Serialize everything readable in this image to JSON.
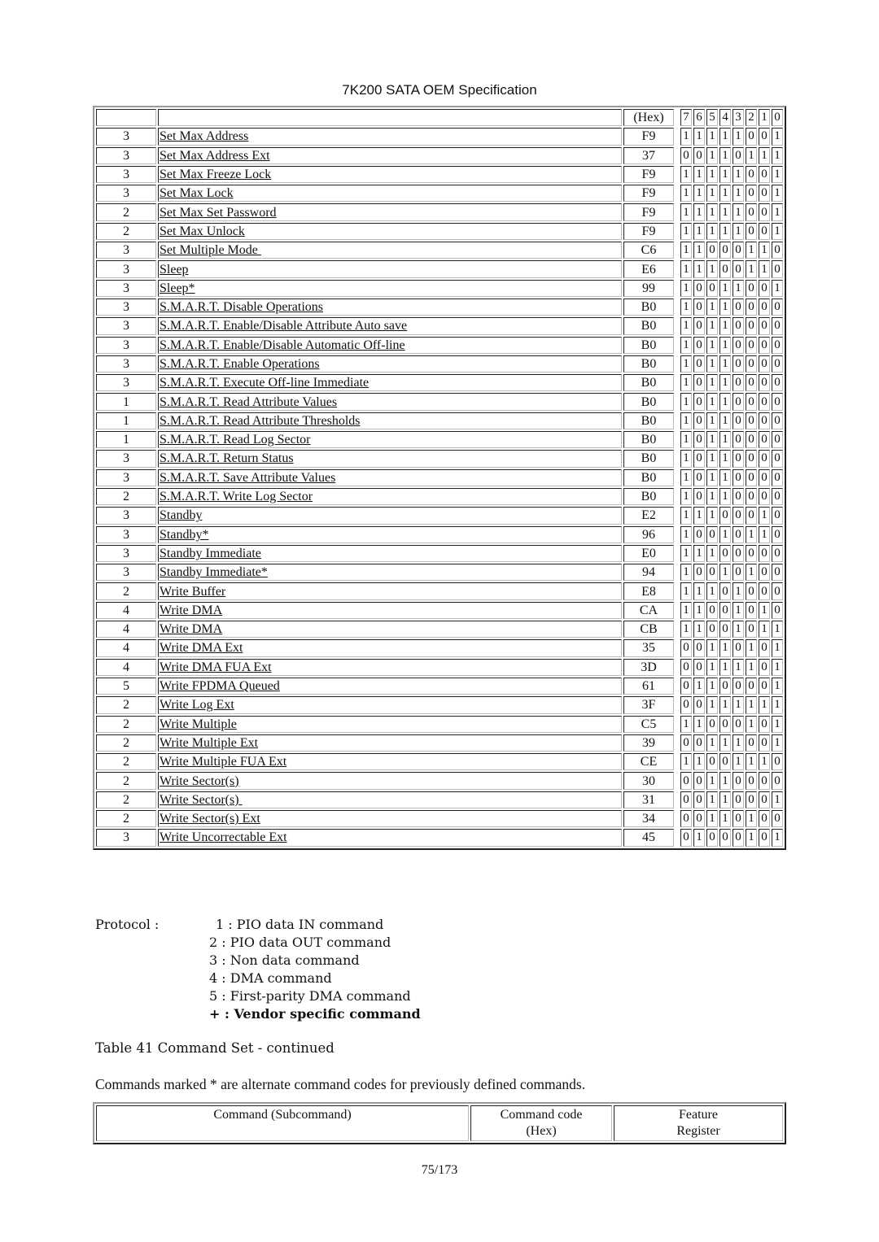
{
  "header": {
    "title": "7K200 SATA OEM Specification"
  },
  "table": {
    "header_row": {
      "protocol": "",
      "command": "",
      "hex": "(Hex)",
      "bits": [
        "7",
        "6",
        "5",
        "4",
        "3",
        "2",
        "1",
        "0"
      ]
    },
    "rows": [
      {
        "protocol": "3",
        "command": "Set Max Address",
        "hex": "F9",
        "bits": [
          "1",
          "1",
          "1",
          "1",
          "1",
          "0",
          "0",
          "1"
        ]
      },
      {
        "protocol": "3",
        "command": "Set Max Address Ext",
        "hex": "37",
        "bits": [
          "0",
          "0",
          "1",
          "1",
          "0",
          "1",
          "1",
          "1"
        ]
      },
      {
        "protocol": "3",
        "command": "Set Max Freeze Lock",
        "hex": "F9",
        "bits": [
          "1",
          "1",
          "1",
          "1",
          "1",
          "0",
          "0",
          "1"
        ]
      },
      {
        "protocol": "3",
        "command": "Set Max Lock",
        "hex": "F9",
        "bits": [
          "1",
          "1",
          "1",
          "1",
          "1",
          "0",
          "0",
          "1"
        ]
      },
      {
        "protocol": "2",
        "command": "Set Max Set Password",
        "hex": "F9",
        "bits": [
          "1",
          "1",
          "1",
          "1",
          "1",
          "0",
          "0",
          "1"
        ]
      },
      {
        "protocol": "2",
        "command": "Set Max Unlock",
        "hex": "F9",
        "bits": [
          "1",
          "1",
          "1",
          "1",
          "1",
          "0",
          "0",
          "1"
        ]
      },
      {
        "protocol": "3",
        "command": "Set Multiple Mode ",
        "hex": "C6",
        "bits": [
          "1",
          "1",
          "0",
          "0",
          "0",
          "1",
          "1",
          "0"
        ]
      },
      {
        "protocol": "3",
        "command": "Sleep",
        "hex": "E6",
        "bits": [
          "1",
          "1",
          "1",
          "0",
          "0",
          "1",
          "1",
          "0"
        ]
      },
      {
        "protocol": "3",
        "command": "Sleep*",
        "hex": "99",
        "bits": [
          "1",
          "0",
          "0",
          "1",
          "1",
          "0",
          "0",
          "1"
        ]
      },
      {
        "protocol": "3",
        "command": "S.M.A.R.T. Disable Operations",
        "hex": "B0",
        "bits": [
          "1",
          "0",
          "1",
          "1",
          "0",
          "0",
          "0",
          "0"
        ]
      },
      {
        "protocol": "3",
        "command": "S.M.A.R.T. Enable/Disable Attribute Auto save",
        "hex": "B0",
        "bits": [
          "1",
          "0",
          "1",
          "1",
          "0",
          "0",
          "0",
          "0"
        ]
      },
      {
        "protocol": "3",
        "command": "S.M.A.R.T. Enable/Disable Automatic Off-line",
        "hex": "B0",
        "bits": [
          "1",
          "0",
          "1",
          "1",
          "0",
          "0",
          "0",
          "0"
        ]
      },
      {
        "protocol": "3",
        "command": "S.M.A.R.T. Enable Operations",
        "hex": "B0",
        "bits": [
          "1",
          "0",
          "1",
          "1",
          "0",
          "0",
          "0",
          "0"
        ]
      },
      {
        "protocol": "3",
        "command": "S.M.A.R.T. Execute Off-line Immediate",
        "hex": "B0",
        "bits": [
          "1",
          "0",
          "1",
          "1",
          "0",
          "0",
          "0",
          "0"
        ]
      },
      {
        "protocol": "1",
        "command": "S.M.A.R.T. Read Attribute Values",
        "hex": "B0",
        "bits": [
          "1",
          "0",
          "1",
          "1",
          "0",
          "0",
          "0",
          "0"
        ]
      },
      {
        "protocol": "1",
        "command": "S.M.A.R.T. Read Attribute Thresholds",
        "hex": "B0",
        "bits": [
          "1",
          "0",
          "1",
          "1",
          "0",
          "0",
          "0",
          "0"
        ]
      },
      {
        "protocol": "1",
        "command": "S.M.A.R.T. Read Log Sector",
        "hex": "B0",
        "bits": [
          "1",
          "0",
          "1",
          "1",
          "0",
          "0",
          "0",
          "0"
        ]
      },
      {
        "protocol": "3",
        "command": "S.M.A.R.T. Return Status",
        "hex": "B0",
        "bits": [
          "1",
          "0",
          "1",
          "1",
          "0",
          "0",
          "0",
          "0"
        ]
      },
      {
        "protocol": "3",
        "command": "S.M.A.R.T. Save Attribute Values",
        "hex": "B0",
        "bits": [
          "1",
          "0",
          "1",
          "1",
          "0",
          "0",
          "0",
          "0"
        ]
      },
      {
        "protocol": "2",
        "command": "S.M.A.R.T. Write Log Sector",
        "hex": "B0",
        "bits": [
          "1",
          "0",
          "1",
          "1",
          "0",
          "0",
          "0",
          "0"
        ]
      },
      {
        "protocol": "3",
        "command": "Standby",
        "hex": "E2",
        "bits": [
          "1",
          "1",
          "1",
          "0",
          "0",
          "0",
          "1",
          "0"
        ]
      },
      {
        "protocol": "3",
        "command": "Standby*",
        "hex": "96",
        "bits": [
          "1",
          "0",
          "0",
          "1",
          "0",
          "1",
          "1",
          "0"
        ]
      },
      {
        "protocol": "3",
        "command": "Standby Immediate",
        "hex": "E0",
        "bits": [
          "1",
          "1",
          "1",
          "0",
          "0",
          "0",
          "0",
          "0"
        ]
      },
      {
        "protocol": "3",
        "command": "Standby Immediate*",
        "hex": "94",
        "bits": [
          "1",
          "0",
          "0",
          "1",
          "0",
          "1",
          "0",
          "0"
        ]
      },
      {
        "protocol": "2",
        "command": "Write Buffer",
        "hex": "E8",
        "bits": [
          "1",
          "1",
          "1",
          "0",
          "1",
          "0",
          "0",
          "0"
        ]
      },
      {
        "protocol": "4",
        "command": "Write DMA",
        "hex": "CA",
        "bits": [
          "1",
          "1",
          "0",
          "0",
          "1",
          "0",
          "1",
          "0"
        ]
      },
      {
        "protocol": "4",
        "command": "Write DMA",
        "hex": "CB",
        "bits": [
          "1",
          "1",
          "0",
          "0",
          "1",
          "0",
          "1",
          "1"
        ]
      },
      {
        "protocol": "4",
        "command": "Write DMA Ext",
        "hex": "35",
        "bits": [
          "0",
          "0",
          "1",
          "1",
          "0",
          "1",
          "0",
          "1"
        ]
      },
      {
        "protocol": "4",
        "command": "Write DMA FUA Ext",
        "hex": "3D",
        "bits": [
          "0",
          "0",
          "1",
          "1",
          "1",
          "1",
          "0",
          "1"
        ]
      },
      {
        "protocol": "5",
        "command": "Write FPDMA Queued",
        "hex": "61",
        "bits": [
          "0",
          "1",
          "1",
          "0",
          "0",
          "0",
          "0",
          "1"
        ]
      },
      {
        "protocol": "2",
        "command": "Write Log Ext",
        "hex": "3F",
        "bits": [
          "0",
          "0",
          "1",
          "1",
          "1",
          "1",
          "1",
          "1"
        ]
      },
      {
        "protocol": "2",
        "command": "Write Multiple",
        "hex": "C5",
        "bits": [
          "1",
          "1",
          "0",
          "0",
          "0",
          "1",
          "0",
          "1"
        ]
      },
      {
        "protocol": "2",
        "command": "Write Multiple Ext",
        "hex": "39",
        "bits": [
          "0",
          "0",
          "1",
          "1",
          "1",
          "0",
          "0",
          "1"
        ]
      },
      {
        "protocol": "2",
        "command": "Write Multiple FUA Ext",
        "hex": "CE",
        "bits": [
          "1",
          "1",
          "0",
          "0",
          "1",
          "1",
          "1",
          "0"
        ]
      },
      {
        "protocol": "2",
        "command": "Write Sector(s)",
        "hex": "30",
        "bits": [
          "0",
          "0",
          "1",
          "1",
          "0",
          "0",
          "0",
          "0"
        ]
      },
      {
        "protocol": "2",
        "command": "Write Sector(s) ",
        "hex": "31",
        "bits": [
          "0",
          "0",
          "1",
          "1",
          "0",
          "0",
          "0",
          "1"
        ]
      },
      {
        "protocol": "2",
        "command": "Write Sector(s) Ext",
        "hex": "34",
        "bits": [
          "0",
          "0",
          "1",
          "1",
          "0",
          "1",
          "0",
          "0"
        ]
      },
      {
        "protocol": "3",
        "command": "Write Uncorrectable Ext",
        "hex": "45",
        "bits": [
          "0",
          "1",
          "0",
          "0",
          "0",
          "1",
          "0",
          "1"
        ]
      }
    ]
  },
  "legend": {
    "label": "Protocol :",
    "items": [
      "1 : PIO data IN command",
      "2 : PIO data OUT command",
      "3 : Non data command",
      "4 : DMA command",
      "5 : First-parity DMA command",
      "+ : Vendor specific command"
    ]
  },
  "caption": "Table 41 Command Set - continued",
  "note": "Commands marked * are alternate command codes for previously defined commands.",
  "next_table_header": {
    "command": "Command (Subcommand)",
    "code_line1": "Command code",
    "code_line2": "(Hex)",
    "feature_line1": "Feature",
    "feature_line2": "Register"
  },
  "footer": {
    "page": "75/173"
  }
}
